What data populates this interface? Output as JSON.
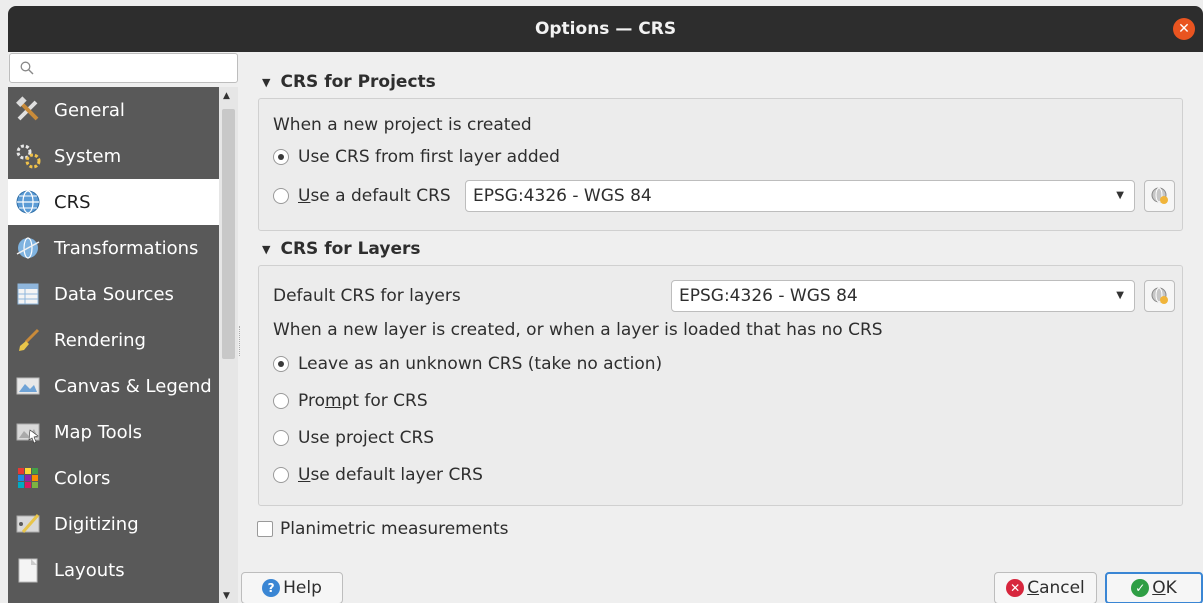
{
  "window": {
    "title": "Options — CRS"
  },
  "search": {
    "placeholder": ""
  },
  "sidebar": {
    "items": [
      {
        "label": "General",
        "icon": "tools-icon",
        "active": false
      },
      {
        "label": "System",
        "icon": "gears-icon",
        "active": false
      },
      {
        "label": "CRS",
        "icon": "globe-icon",
        "active": true
      },
      {
        "label": "Transformations",
        "icon": "globe-transform-icon",
        "active": false
      },
      {
        "label": "Data Sources",
        "icon": "table-icon",
        "active": false
      },
      {
        "label": "Rendering",
        "icon": "brush-icon",
        "active": false
      },
      {
        "label": "Canvas & Legend",
        "icon": "canvas-icon",
        "active": false
      },
      {
        "label": "Map Tools",
        "icon": "map-tools-icon",
        "active": false
      },
      {
        "label": "Colors",
        "icon": "colors-icon",
        "active": false
      },
      {
        "label": "Digitizing",
        "icon": "digitizing-icon",
        "active": false
      },
      {
        "label": "Layouts",
        "icon": "layouts-icon",
        "active": false
      }
    ]
  },
  "projects": {
    "header": "CRS for Projects",
    "intro": "When a new project is created",
    "radio_first_layer": "Use CRS from first layer added",
    "radio_default_prefix": "U",
    "radio_default_rest": "se a default CRS",
    "default_crs_value": "EPSG:4326 - WGS 84"
  },
  "layers": {
    "header": "CRS for Layers",
    "default_label": "Default CRS for layers",
    "default_value": "EPSG:4326 - WGS 84",
    "intro": "When a new layer is created, or when a layer is loaded that has no CRS",
    "opt_unknown": "Leave as an unknown CRS (take no action)",
    "opt_prompt_a": "Pro",
    "opt_prompt_u": "m",
    "opt_prompt_b": "pt for CRS",
    "opt_project": "Use project CRS",
    "opt_default_u": "U",
    "opt_default_rest": "se default layer CRS"
  },
  "planimetric": {
    "label": "Planimetric measurements"
  },
  "buttons": {
    "help": "Help",
    "cancel_u": "C",
    "cancel_rest": "ancel",
    "ok_u": "O",
    "ok_rest": "K"
  },
  "colors": {
    "accent": "#3a86d4",
    "close": "#e95420",
    "sidebar_bg": "#595959"
  }
}
